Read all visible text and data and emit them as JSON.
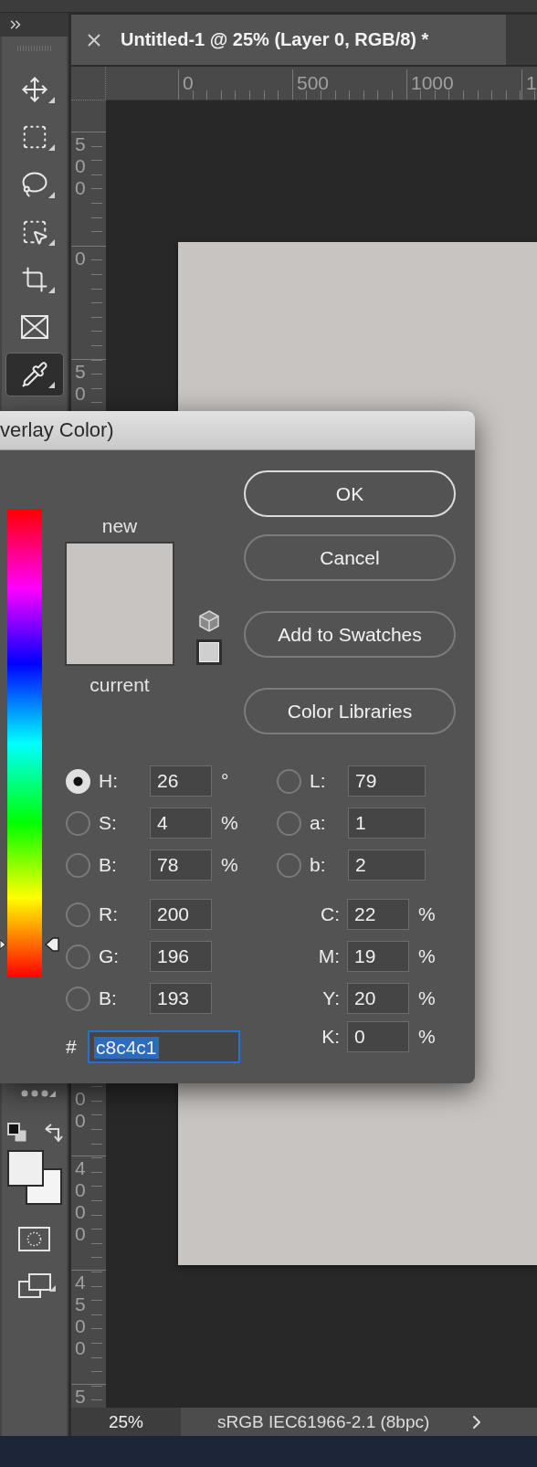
{
  "toolbar": {
    "tools": [
      {
        "kind": "move",
        "selected": false
      },
      {
        "kind": "marquee",
        "selected": false
      },
      {
        "kind": "lasso",
        "selected": false
      },
      {
        "kind": "object_select",
        "selected": false
      },
      {
        "kind": "crop",
        "selected": false
      },
      {
        "kind": "frame",
        "selected": false
      },
      {
        "kind": "eyedropper",
        "selected": true
      }
    ],
    "lower_tools": [
      {
        "kind": "more"
      },
      {
        "kind": "default_colors"
      },
      {
        "kind": "swatches"
      },
      {
        "kind": "quick_mask"
      },
      {
        "kind": "screen_mode"
      }
    ]
  },
  "document_tab": {
    "title": "Untitled-1 @ 25% (Layer 0, RGB/8) *"
  },
  "rulers": {
    "horizontal": [
      "0",
      "500",
      "1000",
      "1"
    ],
    "vertical": [
      "500",
      "0",
      "50",
      "00",
      "4000",
      "4500",
      "5"
    ]
  },
  "dialog": {
    "title": "verlay Color)",
    "hue_slider": {
      "level": 0.07
    },
    "preview": {
      "new_label": "new",
      "current_label": "current"
    },
    "buttons": [
      {
        "label": "OK",
        "default": true
      },
      {
        "label": "Cancel",
        "default": false
      },
      {
        "label": "Add to Swatches",
        "default": false
      },
      {
        "label": "Color Libraries",
        "default": false
      }
    ],
    "hsb_fields": [
      {
        "label": "H:",
        "value": "26",
        "unit": "°",
        "selected": true
      },
      {
        "label": "S:",
        "value": "4",
        "unit": "%",
        "selected": false
      },
      {
        "label": "B:",
        "value": "78",
        "unit": "%",
        "selected": false
      }
    ],
    "rgb_fields": [
      {
        "label": "R:",
        "value": "200",
        "selected": false
      },
      {
        "label": "G:",
        "value": "196",
        "selected": false
      },
      {
        "label": "B:",
        "value": "193",
        "selected": false
      }
    ],
    "lab_fields": [
      {
        "label": "L:",
        "value": "79",
        "selected": false
      },
      {
        "label": "a:",
        "value": "1",
        "selected": false
      },
      {
        "label": "b:",
        "value": "2",
        "selected": false
      }
    ],
    "cmyk_fields": [
      {
        "label": "C:",
        "value": "22",
        "unit": "%"
      },
      {
        "label": "M:",
        "value": "19",
        "unit": "%"
      },
      {
        "label": "Y:",
        "value": "20",
        "unit": "%"
      },
      {
        "label": "K:",
        "value": "0",
        "unit": "%"
      }
    ],
    "hex": {
      "label": "#",
      "value": "c8c4c1",
      "highlighted": true
    }
  },
  "status_bar": {
    "zoom": "25%",
    "profile": "sRGB IEC61966-2.1 (8bpc)"
  }
}
